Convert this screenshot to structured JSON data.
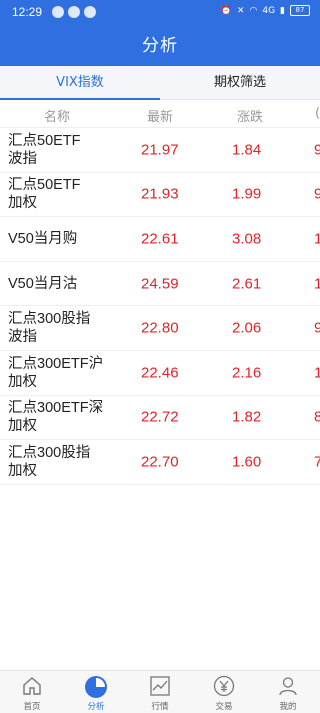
{
  "status": {
    "time": "12:29",
    "right_text": "4G",
    "battery": "87"
  },
  "header": {
    "title": "分析"
  },
  "tabs": [
    {
      "label": "VIX指数",
      "active": true
    },
    {
      "label": "期权筛选",
      "active": false
    }
  ],
  "table": {
    "headers": [
      "名称",
      "最新",
      "涨跌",
      "("
    ],
    "rows": [
      {
        "name": "汇点50ETF\n波指",
        "latest": "21.97",
        "change": "1.84",
        "pct": "9"
      },
      {
        "name": "汇点50ETF\n加权",
        "latest": "21.93",
        "change": "1.99",
        "pct": "9"
      },
      {
        "name": "V50当月购",
        "latest": "22.61",
        "change": "3.08",
        "pct": "1"
      },
      {
        "name": "V50当月沽",
        "latest": "24.59",
        "change": "2.61",
        "pct": "1"
      },
      {
        "name": "汇点300股指\n波指",
        "latest": "22.80",
        "change": "2.06",
        "pct": "9"
      },
      {
        "name": "汇点300ETF沪\n加权",
        "latest": "22.46",
        "change": "2.16",
        "pct": "1"
      },
      {
        "name": "汇点300ETF深\n加权",
        "latest": "22.72",
        "change": "1.82",
        "pct": "8"
      },
      {
        "name": "汇点300股指\n加权",
        "latest": "22.70",
        "change": "1.60",
        "pct": "7"
      }
    ]
  },
  "nav": [
    {
      "label": "首页",
      "icon": "home-icon",
      "active": false
    },
    {
      "label": "分析",
      "icon": "pie-chart-icon",
      "active": true
    },
    {
      "label": "行情",
      "icon": "trend-chart-icon",
      "active": false
    },
    {
      "label": "交易",
      "icon": "yen-icon",
      "active": false
    },
    {
      "label": "我的",
      "icon": "person-icon",
      "active": false
    }
  ],
  "colors": {
    "accent": "#2f6fe0",
    "up": "#e0242a"
  }
}
